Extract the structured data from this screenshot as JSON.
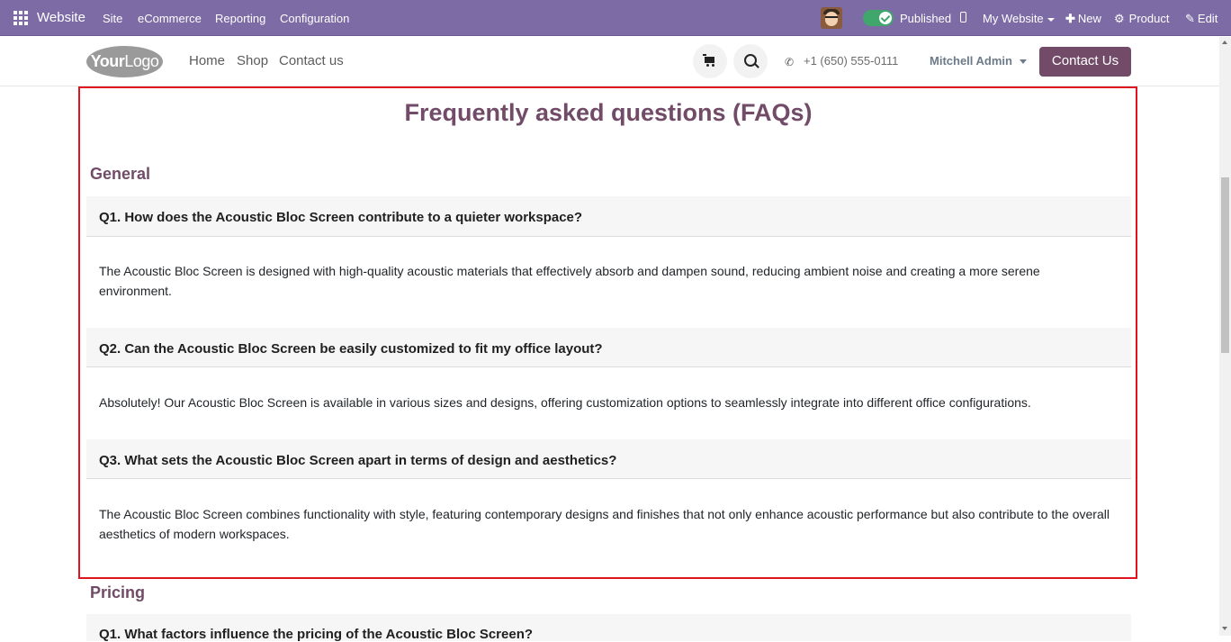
{
  "admin_bar": {
    "app_name": "Website",
    "menu": [
      "Site",
      "eCommerce",
      "Reporting",
      "Configuration"
    ],
    "published_label": "Published",
    "website_label": "My Website",
    "new_label": "New",
    "product_label": "Product",
    "edit_label": "Edit",
    "accent_color": "#7c6ba5"
  },
  "header": {
    "logo_text_bold": "Your",
    "logo_text": "Logo",
    "nav": [
      "Home",
      "Shop",
      "Contact us"
    ],
    "phone": "+1 (650) 555-0111",
    "user": "Mitchell Admin",
    "contact_button": "Contact Us",
    "brand_color": "#714b67"
  },
  "faq": {
    "title": "Frequently asked questions (FAQs)",
    "sections": [
      {
        "heading": "General",
        "items": [
          {
            "question": "Q1. How does the Acoustic Bloc Screen contribute to a quieter workspace?",
            "answer": "The Acoustic Bloc Screen is designed with high-quality acoustic materials that effectively absorb and dampen sound, reducing ambient noise and creating a more serene environment."
          },
          {
            "question": "Q2. Can the Acoustic Bloc Screen be easily customized to fit my office layout?",
            "answer": "Absolutely! Our Acoustic Bloc Screen is available in various sizes and designs, offering customization options to seamlessly integrate into different office configurations."
          },
          {
            "question": "Q3. What sets the Acoustic Bloc Screen apart in terms of design and aesthetics?",
            "answer": "The Acoustic Bloc Screen combines functionality with style, featuring contemporary designs and finishes that not only enhance acoustic performance but also contribute to the overall aesthetics of modern workspaces."
          }
        ]
      },
      {
        "heading": "Pricing",
        "items": [
          {
            "question": "Q1. What factors influence the pricing of the Acoustic Bloc Screen?"
          }
        ]
      }
    ]
  }
}
